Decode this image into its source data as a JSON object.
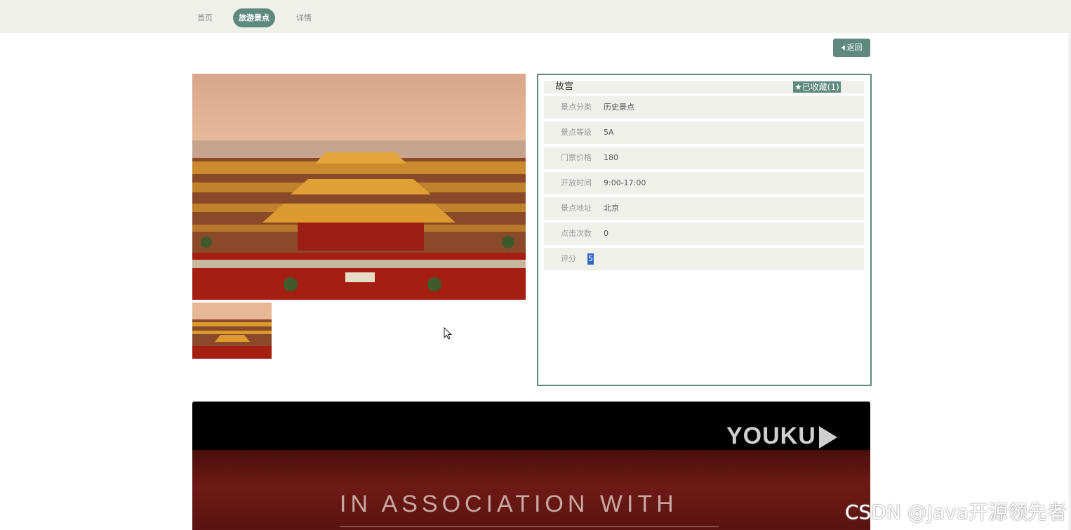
{
  "breadcrumb": {
    "home": "首页",
    "category": "旅游景点",
    "detail": "详情"
  },
  "back_button": "返回",
  "attraction": {
    "title": "故宫",
    "favorite_label": "已收藏(1)",
    "fields": [
      {
        "label": "景点分类",
        "value": "历史景点"
      },
      {
        "label": "景点等级",
        "value": "5A"
      },
      {
        "label": "门票价格",
        "value": "180"
      },
      {
        "label": "开放时间",
        "value": "9:00-17:00"
      },
      {
        "label": "景点地址",
        "value": "北京"
      },
      {
        "label": "点击次数",
        "value": "0"
      },
      {
        "label": "评分",
        "value": "5"
      }
    ]
  },
  "video": {
    "logo_text": "YOUKU",
    "caption": "IN ASSOCIATION WITH"
  },
  "watermark": "CSDN @Java开源领先者",
  "colors": {
    "accent": "#5d8a7d",
    "row_bg": "#f0f0eb",
    "topbar_bg": "#f0f0eb",
    "selection": "#3267c8"
  }
}
